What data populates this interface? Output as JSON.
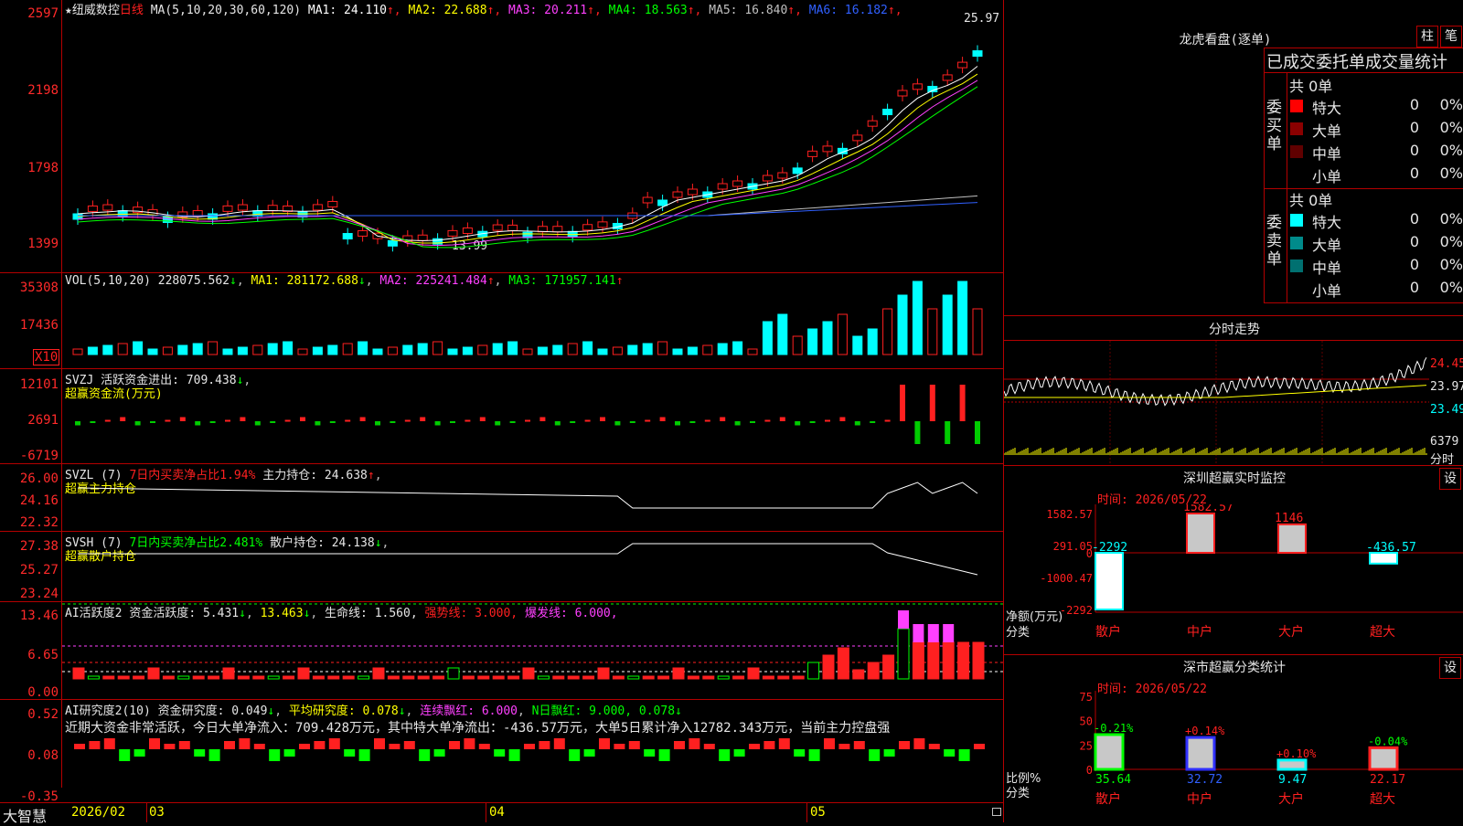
{
  "stock": {
    "star": "★",
    "name": "纽威数控",
    "period": "日线"
  },
  "ma_line": {
    "params": "MA(5,10,20,30,60,120)",
    "items": [
      {
        "label": "MA1:",
        "value": "24.110",
        "color": "#ffffff"
      },
      {
        "label": "MA2:",
        "value": "22.688",
        "color": "#ffff00"
      },
      {
        "label": "MA3:",
        "value": "20.211",
        "color": "#ff40ff"
      },
      {
        "label": "MA4:",
        "value": "18.563",
        "color": "#00ff00"
      },
      {
        "label": "MA5:",
        "value": "16.840",
        "color": "#c0c0c0"
      },
      {
        "label": "MA6:",
        "value": "16.182",
        "color": "#3060ff"
      }
    ]
  },
  "price_axis": [
    "2597",
    "2198",
    "1798",
    "1399"
  ],
  "price_marks": {
    "high": "25.97",
    "low": "13.99"
  },
  "vol": {
    "title": "VOL(5,10,20)",
    "value": "228075.562",
    "ma1": "MA1: 281172.688",
    "ma2": "MA2: 225241.484",
    "ma3": "MA3: 171957.141",
    "axis": [
      "35308",
      "17436"
    ],
    "unit": "X10"
  },
  "svzj": {
    "title": "SVZJ",
    "label": "活跃资金进出:",
    "value": "709.438",
    "sub": "超赢资金流(万元)",
    "axis": [
      "12101",
      "2691",
      "-6719"
    ]
  },
  "svzl": {
    "title": "SVZL (7)",
    "ratio": "7日内买卖净占比1.94%",
    "label": "主力持仓:",
    "value": "24.638",
    "sub": "超赢主力持仓",
    "axis": [
      "26.00",
      "24.16",
      "22.32"
    ]
  },
  "svsh": {
    "title": "SVSH (7)",
    "ratio": "7日内买卖净占比2.481%",
    "label": "散户持仓:",
    "value": "24.138",
    "sub": "超赢散户持仓",
    "axis": [
      "27.38",
      "25.27",
      "23.24"
    ]
  },
  "ai_act": {
    "title": "AI活跃度2",
    "label": "资金活跃度:",
    "v1": "5.431",
    "v2": "13.463",
    "life": "生命线: 1.560,",
    "strong": "强势线: 3.000,",
    "burst": "爆发线: 6.000,",
    "axis": [
      "13.46",
      "6.65",
      "0.00"
    ]
  },
  "ai_res": {
    "title": "AI研究度2(10)",
    "label": "资金研究度:",
    "v1": "0.049",
    "avg": "平均研究度: 0.078",
    "red1": "连续飘红: 6.000",
    "red2": "N日飘红: 9.000, 0.078",
    "axis": [
      "0.52",
      "0.08",
      "-0.35"
    ],
    "note": "近期大资金非常活跃，今日大单净流入：709.428万元，其中特大单净流出：-436.57万元，大单5日累计净入12782.343万元，当前主力控盘强"
  },
  "footer": {
    "brand": "大智慧",
    "dates": [
      "2026/02",
      "03",
      "04",
      "05"
    ]
  },
  "dragon": {
    "title": "龙虎看盘(逐单)",
    "btn1": "柱",
    "btn2": "笔",
    "header": "已成交委托单成交量统计",
    "buy": {
      "side": "委买单",
      "total": "共 0单",
      "rows": [
        {
          "name": "特大",
          "n": "0",
          "p": "0%",
          "color": "#ff0000"
        },
        {
          "name": "大单",
          "n": "0",
          "p": "0%",
          "color": "#8b0000"
        },
        {
          "name": "中单",
          "n": "0",
          "p": "0%",
          "color": "#600000"
        },
        {
          "name": "小单",
          "n": "0",
          "p": "0%",
          "color": "#000000"
        }
      ]
    },
    "sell": {
      "side": "委卖单",
      "total": "共 0单",
      "rows": [
        {
          "name": "特大",
          "n": "0",
          "p": "0%",
          "color": "#00ffff"
        },
        {
          "name": "大单",
          "n": "0",
          "p": "0%",
          "color": "#008b8b"
        },
        {
          "name": "中单",
          "n": "0",
          "p": "0%",
          "color": "#007070"
        },
        {
          "name": "小单",
          "n": "0",
          "p": "0%",
          "color": "#000000"
        }
      ]
    }
  },
  "intraday": {
    "title": "分时走势",
    "prices": [
      "24.45",
      "23.97",
      "23.49"
    ],
    "vol": "6379",
    "unit": "分时"
  },
  "sz_monitor": {
    "title": "深圳超赢实时监控",
    "btn": "设",
    "time": "时间: 2026/05/22",
    "axis": [
      "1582.57",
      "291.05",
      "0",
      "-1000.47",
      "-2292"
    ],
    "ylabel": "净额(万元)",
    "xlabel": "分类",
    "bars": [
      {
        "cat": "散户",
        "value": -2292,
        "label": "-2292"
      },
      {
        "cat": "中户",
        "value": 1582.57,
        "label": "1582.57"
      },
      {
        "cat": "大户",
        "value": 1146,
        "label": "1146"
      },
      {
        "cat": "超大",
        "value": -436.57,
        "label": "-436.57"
      }
    ]
  },
  "sz_class": {
    "title": "深市超赢分类统计",
    "btn": "设",
    "time": "时间: 2026/05/22",
    "axis": [
      "75",
      "50",
      "25",
      "0"
    ],
    "ylabel": "比例%",
    "xlabel": "分类",
    "bars": [
      {
        "cat": "散户",
        "value": 35.64,
        "delta": "-0.21%",
        "color": "#00ff00"
      },
      {
        "cat": "中户",
        "value": 32.72,
        "delta": "+0.14%",
        "color": "#3030ff"
      },
      {
        "cat": "大户",
        "value": 9.47,
        "delta": "+0.10%",
        "color": "#00ffff"
      },
      {
        "cat": "超大",
        "value": 22.17,
        "delta": "-0.04%",
        "color": "#ff2020"
      }
    ]
  }
}
